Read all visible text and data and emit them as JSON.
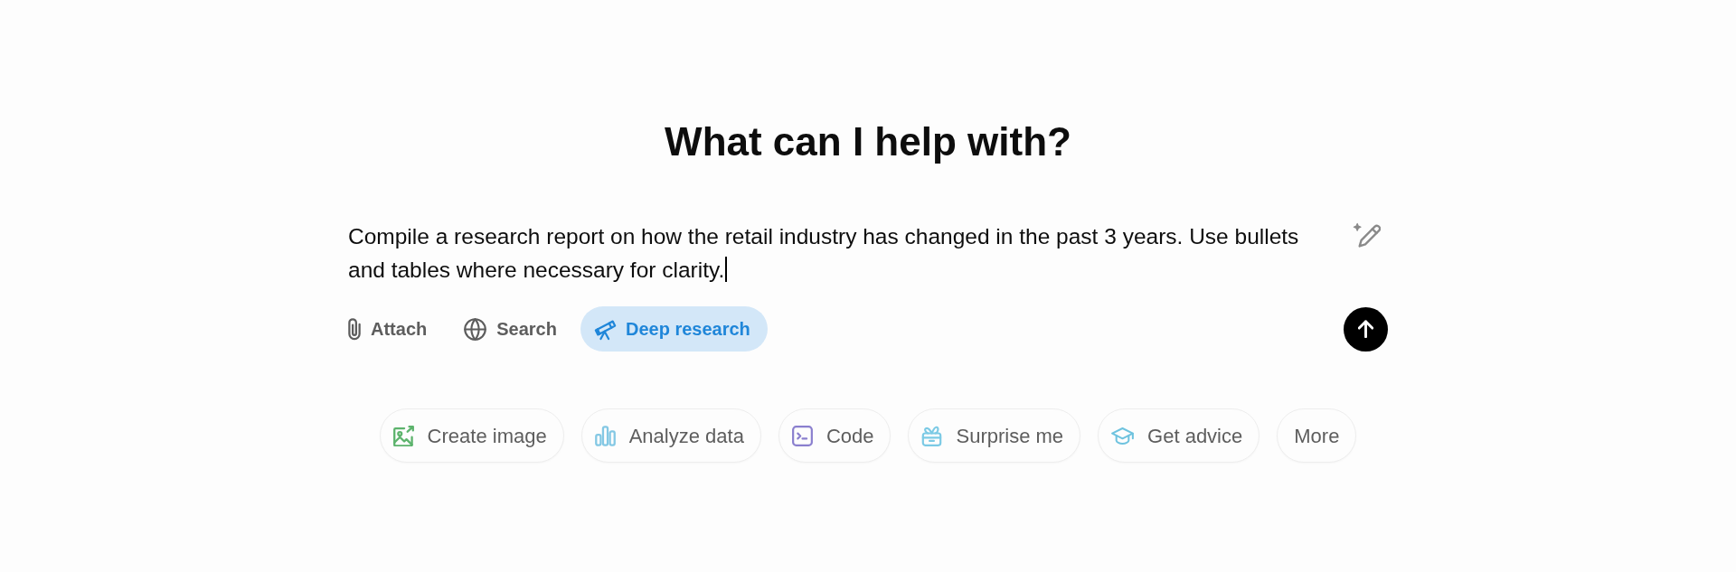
{
  "heading": "What can I help with?",
  "composer": {
    "value": "Compile a research report on how the retail industry has changed in the past 3 years. Use bullets and tables where necessary for clarity.",
    "tools": [
      {
        "label": "Attach",
        "kind": "attach",
        "selected": false
      },
      {
        "label": "Search",
        "kind": "search",
        "selected": false
      },
      {
        "label": "Deep research",
        "kind": "deep_research",
        "selected": true
      }
    ]
  },
  "suggestions": [
    {
      "label": "Create image",
      "kind": "image",
      "color": "#5cb36c"
    },
    {
      "label": "Analyze data",
      "kind": "chart",
      "color": "#84c8e4"
    },
    {
      "label": "Code",
      "kind": "code",
      "color": "#8a7fce"
    },
    {
      "label": "Surprise me",
      "kind": "gift",
      "color": "#7ccae5"
    },
    {
      "label": "Get advice",
      "kind": "advice",
      "color": "#6fc3df"
    },
    {
      "label": "More",
      "kind": "more"
    }
  ]
}
